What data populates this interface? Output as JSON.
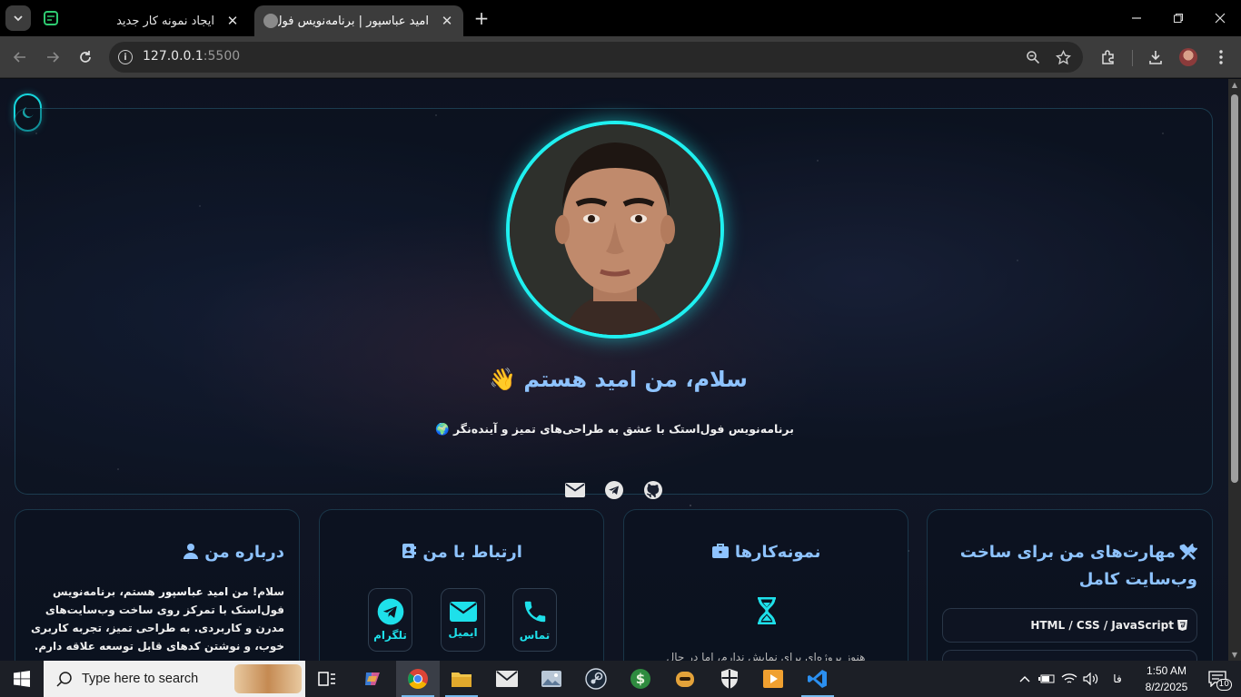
{
  "browser": {
    "tabs": [
      {
        "title": "ایجاد نمونه کار جدید",
        "active": false
      },
      {
        "title": "امید عباسپور | برنامه‌نویس فول‌اس...",
        "active": true
      }
    ],
    "url_host": "127.0.0.1",
    "url_port": ":5500"
  },
  "hero": {
    "title": "سلام، من امید هستم",
    "title_emoji": "👋",
    "subtitle": "برنامه‌نویس فول‌استک با عشق به طراحی‌های تمیز و آینده‌نگر",
    "subtitle_emoji": "🌍"
  },
  "about": {
    "title": "درباره من",
    "text_pre": "سلام! من ",
    "text_bold": "امید عباسپور",
    "text_post": " هستم، برنامه‌نویس فول‌استک با تمرکز روی ساخت وب‌سایت‌های مدرن و کاربردی. به طراحی تمیز، تجربه کاربری خوب، و نوشتن کدهای قابل توسعه علاقه دارم."
  },
  "contact": {
    "title": "ارتباط با من",
    "buttons": [
      {
        "label": "تماس",
        "icon": "phone-icon"
      },
      {
        "label": "ایمیل",
        "icon": "envelope-icon"
      },
      {
        "label": "تلگرام",
        "icon": "telegram-icon"
      }
    ]
  },
  "portfolio": {
    "title": "نمونه‌کارها",
    "empty_text": "هنوز پروژه‌ای برای نمایش ندارم، اما در حال"
  },
  "skills": {
    "title": "مهارت‌های من برای ساخت وب‌سایت کامل",
    "items": [
      "HTML / CSS / JavaScript"
    ]
  },
  "taskbar": {
    "search_placeholder": "Type here to search",
    "time": "1:50 AM",
    "date": "8/2/2025",
    "language": "فا",
    "notification_count": "10"
  },
  "colors": {
    "accent_cyan": "#1ff0f0",
    "heading_blue": "#8ec3ff"
  }
}
